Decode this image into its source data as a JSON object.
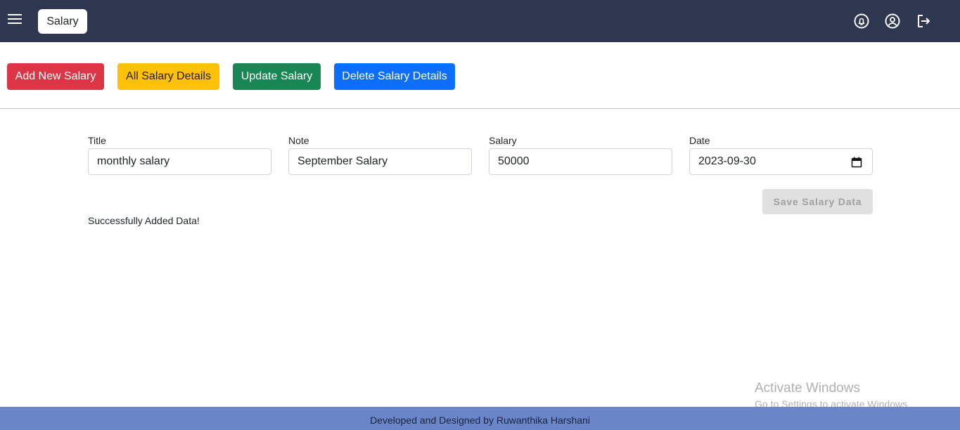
{
  "header": {
    "title": "Salary",
    "icons": [
      "menu-icon",
      "notification-icon",
      "account-icon",
      "logout-icon"
    ]
  },
  "actions": {
    "add_new": "Add New Salary",
    "all_details": "All Salary Details",
    "update": "Update Salary",
    "delete": "Delete Salary Details"
  },
  "form": {
    "title": {
      "label": "Title",
      "value": "monthly salary"
    },
    "note": {
      "label": "Note",
      "value": "September Salary"
    },
    "salary": {
      "label": "Salary",
      "value": "50000"
    },
    "date": {
      "label": "Date",
      "value": "2023-09-30"
    },
    "save_label": "Save Salary Data"
  },
  "status_message": "Successfully Added Data!",
  "watermark": {
    "title": "Activate Windows",
    "subtitle": "Go to Settings to activate Windows."
  },
  "footer": {
    "text": "Developed and Designed by Ruwanthika Harshani"
  },
  "colors": {
    "topbar": "#2e3650",
    "add": "#dc3545",
    "all": "#ffc107",
    "update": "#198754",
    "delete": "#0d6efd",
    "footer": "#6a86c9"
  }
}
